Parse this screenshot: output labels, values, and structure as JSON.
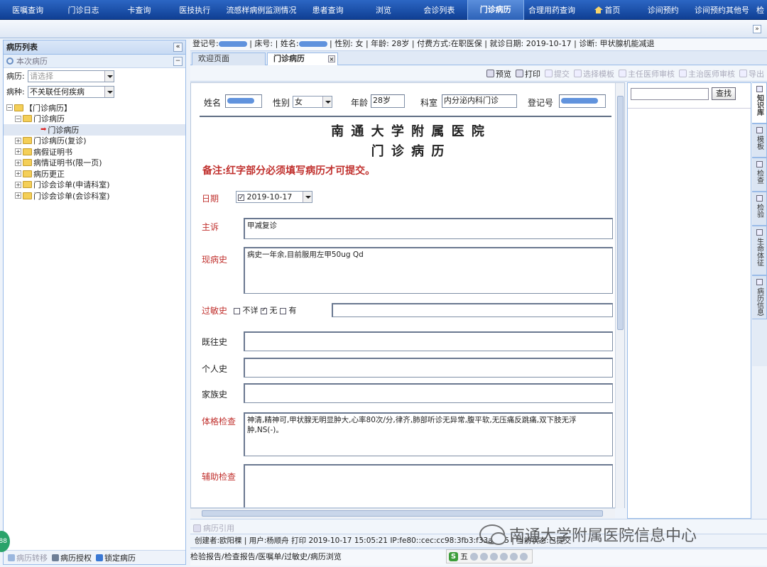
{
  "topnav": {
    "items": [
      "医嘱查询",
      "门诊日志",
      "卡查询",
      "医技执行",
      "流感样病例监测情况",
      "患者查询",
      "浏览",
      "会诊列表",
      "门诊病历",
      "合理用药查询",
      "首页",
      "诊间预约",
      "诊间预约其他号",
      "检"
    ],
    "active_index": 8,
    "home_index": 10
  },
  "left": {
    "title": "病历列表",
    "section": "本次病历",
    "record_label": "病历:",
    "record_placeholder": "请选择",
    "disease_label": "病种:",
    "disease_value": "不关联任何疾病",
    "tree": [
      {
        "label": "【门诊病历】",
        "level": 0,
        "expander": "−",
        "icon": "folder"
      },
      {
        "label": "门诊病历",
        "level": 1,
        "expander": "−",
        "icon": "folder"
      },
      {
        "label": "门诊病历",
        "level": 2,
        "expander": "",
        "icon": "arrow",
        "selected": true
      },
      {
        "label": "门诊病历(复诊)",
        "level": 1,
        "expander": "+",
        "icon": "folder"
      },
      {
        "label": "病假证明书",
        "level": 1,
        "expander": "+",
        "icon": "folder"
      },
      {
        "label": "病情证明书(限一页)",
        "level": 1,
        "expander": "+",
        "icon": "folder"
      },
      {
        "label": "病历更正",
        "level": 1,
        "expander": "+",
        "icon": "folder"
      },
      {
        "label": "门诊会诊单(申请科室)",
        "level": 1,
        "expander": "+",
        "icon": "folder"
      },
      {
        "label": "门诊会诊单(会诊科室)",
        "level": 1,
        "expander": "+",
        "icon": "folder"
      }
    ],
    "footer": [
      "病历转移",
      "病历授权",
      "锁定病历"
    ]
  },
  "infobar": {
    "reg_label": "登记号:",
    "bed_label": "床号:",
    "name_label": "姓名:",
    "gender": "性别: 女",
    "age": "年龄: 28岁",
    "payment": "付费方式:在职医保",
    "visit_date": "就诊日期: 2019-10-17",
    "diagnosis": "诊断: 甲状腺机能减退"
  },
  "tabs": [
    "欢迎页面",
    "门诊病历"
  ],
  "toolbar": [
    "预览",
    "打印",
    "提交",
    "选择模板",
    "主任医师审核",
    "主治医师审核",
    "导出"
  ],
  "form": {
    "name_label": "姓名",
    "gender_label": "性别",
    "gender_value": "女",
    "age_label": "年龄",
    "age_value": "28岁",
    "dept_label": "科室",
    "dept_value": "内分泌内科门诊",
    "reg_label": "登记号",
    "hospital": "南 通 大 学 附 属 医 院",
    "doc_title": "门 诊 病 历",
    "note": "备注:红字部分必须填写病历才可提交。",
    "date_label": "日期",
    "date_value": "2019-10-17",
    "complaint_label": "主诉",
    "complaint_value": "甲减复诊",
    "present_label": "现病史",
    "present_value": "病史一年余,目前服用左甲50ug Qd",
    "allergy_label": "过敏史",
    "allergy_unknown": "不详",
    "allergy_none": "无",
    "allergy_yes": "有",
    "past_label": "既往史",
    "personal_label": "个人史",
    "family_label": "家族史",
    "exam_label": "体格检查",
    "exam_value": "神清,精神可,甲状腺无明显肿大,心率80次/分,律齐,肺部听诊无异常,腹平软,无压痛反跳痛,双下肢无浮肿,NS(-)。",
    "aux_label": "辅助检查"
  },
  "right": {
    "search_btn": "查找",
    "vtabs": [
      "知识库",
      "模板",
      "检查",
      "检验",
      "生命体征",
      "病历信息"
    ]
  },
  "bottom": {
    "ref_label": "病历引用",
    "status": "创建者:欧阳棵  | 用户:杨顺舟  打印 2019-10-17 15:05:21  IP:fe80::cec:cc98:3fb3:f33a%15 | 当前状态:已提交",
    "links": "检验报告/检查报告/医嘱单/过敏史/病历浏览",
    "ime_s": "S",
    "ime_wu": "五"
  },
  "watermark": "南通大学附属医院信息中心",
  "badge": "88"
}
